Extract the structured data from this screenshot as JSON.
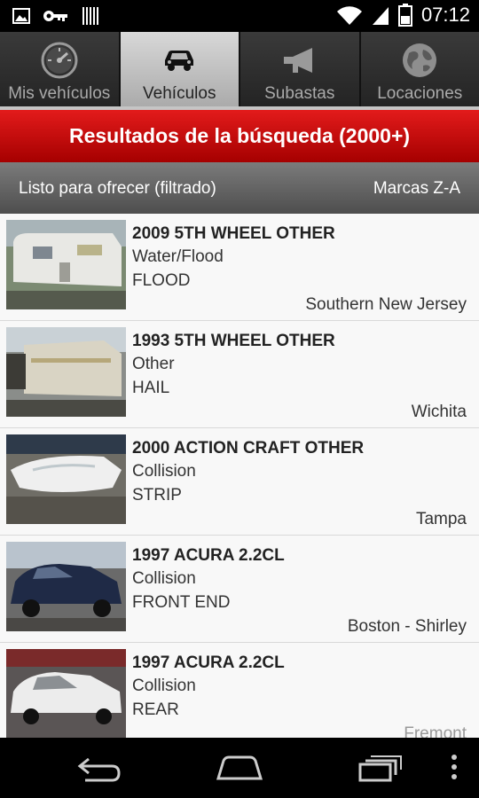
{
  "status": {
    "time": "07:12",
    "icons": [
      "image-icon",
      "key-icon",
      "barcode-icon",
      "wifi-icon",
      "signal-icon",
      "battery-icon"
    ]
  },
  "tabs": [
    {
      "label": "Mis vehículos",
      "icon": "speedometer-icon",
      "active": false
    },
    {
      "label": "Vehículos",
      "icon": "car-icon",
      "active": true
    },
    {
      "label": "Subastas",
      "icon": "megaphone-icon",
      "active": false
    },
    {
      "label": "Locaciones",
      "icon": "globe-icon",
      "active": false
    }
  ],
  "header": {
    "results_title": "Resultados de la búsqueda (2000+)"
  },
  "filter_bar": {
    "filter_label": "Listo para ofrecer (filtrado)",
    "sort_label": "Marcas Z-A"
  },
  "listings": [
    {
      "title": "2009 5TH WHEEL OTHER",
      "damage": "Water/Flood",
      "code": "FLOOD",
      "location": "Southern New Jersey"
    },
    {
      "title": "1993 5TH WHEEL OTHER",
      "damage": "Other",
      "code": "HAIL",
      "location": "Wichita"
    },
    {
      "title": "2000 ACTION CRAFT OTHER",
      "damage": "Collision",
      "code": "STRIP",
      "location": "Tampa"
    },
    {
      "title": "1997 ACURA 2.2CL",
      "damage": "Collision",
      "code": "FRONT END",
      "location": "Boston - Shirley"
    },
    {
      "title": "1997 ACURA 2.2CL",
      "damage": "Collision",
      "code": "REAR",
      "location": "Fremont"
    }
  ],
  "colors": {
    "accent_red": "#c40000",
    "active_tab": "#c4c4c4"
  }
}
